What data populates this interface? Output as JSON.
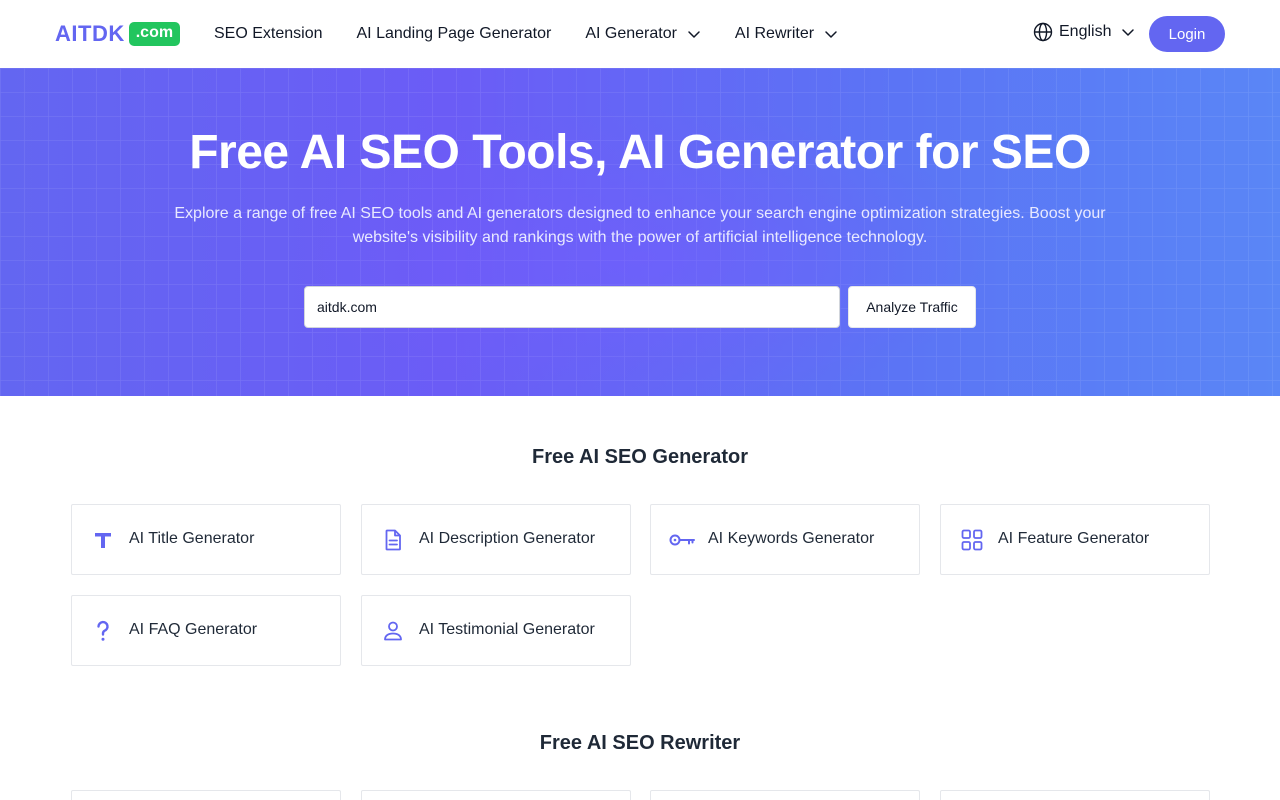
{
  "header": {
    "logo_text": "AITDK",
    "logo_badge": ".com",
    "nav": [
      {
        "label": "SEO Extension"
      },
      {
        "label": "AI Landing Page Generator"
      },
      {
        "label": "AI Generator"
      },
      {
        "label": "AI Rewriter"
      }
    ],
    "language": "English",
    "login_label": "Login"
  },
  "hero": {
    "title": "Free AI SEO Tools, AI Generator for SEO",
    "subtitle": "Explore a range of free AI SEO tools and AI generators designed to enhance your search engine optimization strategies. Boost your website's visibility and rankings with the power of artificial intelligence technology.",
    "input_value": "aitdk.com",
    "button_label": "Analyze Traffic"
  },
  "generator_section": {
    "title": "Free AI SEO Generator",
    "cards": [
      {
        "label": "AI Title Generator",
        "icon": "title-icon"
      },
      {
        "label": "AI Description Generator",
        "icon": "document-icon"
      },
      {
        "label": "AI Keywords Generator",
        "icon": "key-icon"
      },
      {
        "label": "AI Feature Generator",
        "icon": "grid-icon"
      },
      {
        "label": "AI FAQ Generator",
        "icon": "question-icon"
      },
      {
        "label": "AI Testimonial Generator",
        "icon": "user-icon"
      }
    ]
  },
  "rewriter_section": {
    "title": "Free AI SEO Rewriter"
  },
  "colors": {
    "brand": "#6366f1",
    "badge": "#22c55e"
  }
}
